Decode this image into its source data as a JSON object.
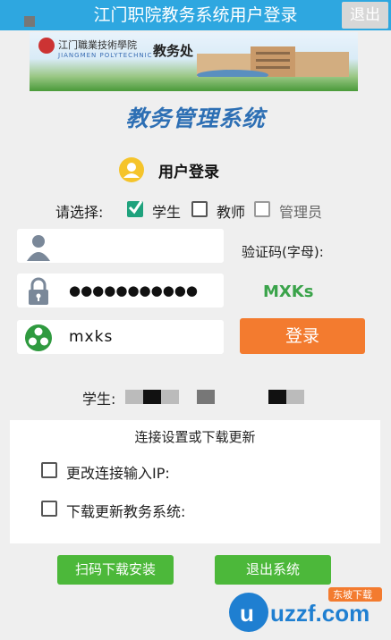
{
  "header": {
    "title": "江门职院教务系统用户登录",
    "exit_label": "退出"
  },
  "banner": {
    "school_cn": "江门職業技術學院",
    "school_en": "JIANGMEN POLYTECHNIC",
    "office": "教务处"
  },
  "system_title": "教务管理系统",
  "login_heading": "用户登录",
  "role": {
    "label": "请选择:",
    "options": [
      {
        "label": "学生",
        "checked": true
      },
      {
        "label": "教师",
        "checked": false
      },
      {
        "label": "管理员",
        "checked": false
      }
    ]
  },
  "form": {
    "username": "",
    "password_mask": "●●●●●●●●●●●",
    "captcha_input": "mxks",
    "captcha_label": "验证码(字母):",
    "captcha_value": "MXKs",
    "login_label": "登录"
  },
  "student_label": "学生:",
  "settings": {
    "title": "连接设置或下载更新",
    "options": [
      {
        "label": "更改连接输入IP:",
        "checked": false
      },
      {
        "label": "下载更新教务系统:",
        "checked": false
      }
    ]
  },
  "buttons": {
    "scan_download": "扫码下载安装",
    "exit_system": "退出系统"
  },
  "watermark": {
    "text": "uzzf.com",
    "tag": "东坡下载"
  },
  "colors": {
    "header": "#2ea7e0",
    "accent_green": "#4cb83a",
    "login_orange": "#f37b2f",
    "checkbox_on": "#1fa27d"
  }
}
